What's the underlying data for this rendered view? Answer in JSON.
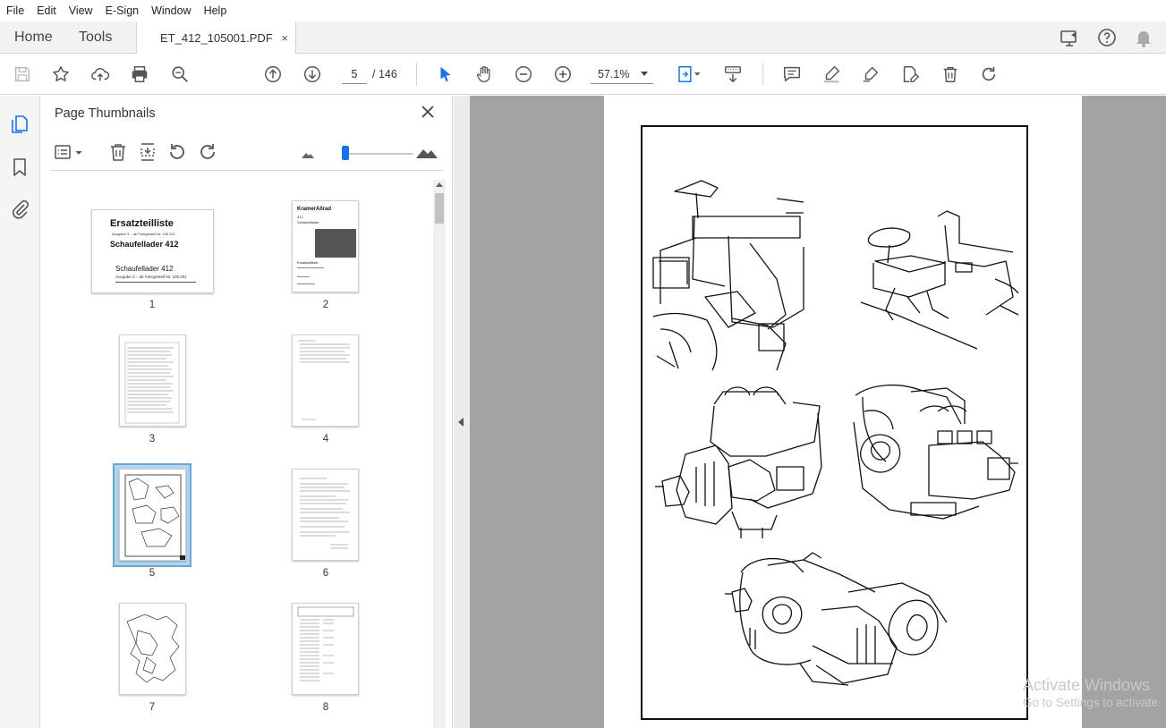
{
  "menu": [
    "File",
    "Edit",
    "View",
    "E-Sign",
    "Window",
    "Help"
  ],
  "tabs": {
    "home": "Home",
    "tools": "Tools",
    "document": "ET_412_105001.PDF",
    "close_glyph": "×"
  },
  "toolbar": {
    "current_page": "5",
    "total_pages": "/ 146",
    "zoom": "57.1%"
  },
  "panel": {
    "title": "Page Thumbnails",
    "close_glyph": "×",
    "thumbnails": [
      {
        "num": "1",
        "selected": false
      },
      {
        "num": "2",
        "selected": false
      },
      {
        "num": "3",
        "selected": false
      },
      {
        "num": "4",
        "selected": false
      },
      {
        "num": "5",
        "selected": true
      },
      {
        "num": "6",
        "selected": false
      },
      {
        "num": "7",
        "selected": false
      },
      {
        "num": "8",
        "selected": false
      }
    ],
    "thumb1": {
      "title": "Ersatzteilliste",
      "line1": "Ausgabe 3 – ab Fahrgestell-Nr. 105.001",
      "model": "Schaufellader 412",
      "model2": "Schaufellader 412",
      "line2": "Ausgabe 3 – ab Fahrgestell-Nr. 105.001"
    },
    "thumb2": {
      "brand": "KramerAllrad",
      "model": "412",
      "subtitle": "Schaufellader",
      "heading": "Ersatzteilliste"
    }
  },
  "watermark": {
    "line1": "Activate Windows",
    "line2": "Go to Settings to activate"
  },
  "colors": {
    "accent": "#1473e6",
    "viewer_bg": "#a3a3a3",
    "selection": "#b3d4ec"
  }
}
